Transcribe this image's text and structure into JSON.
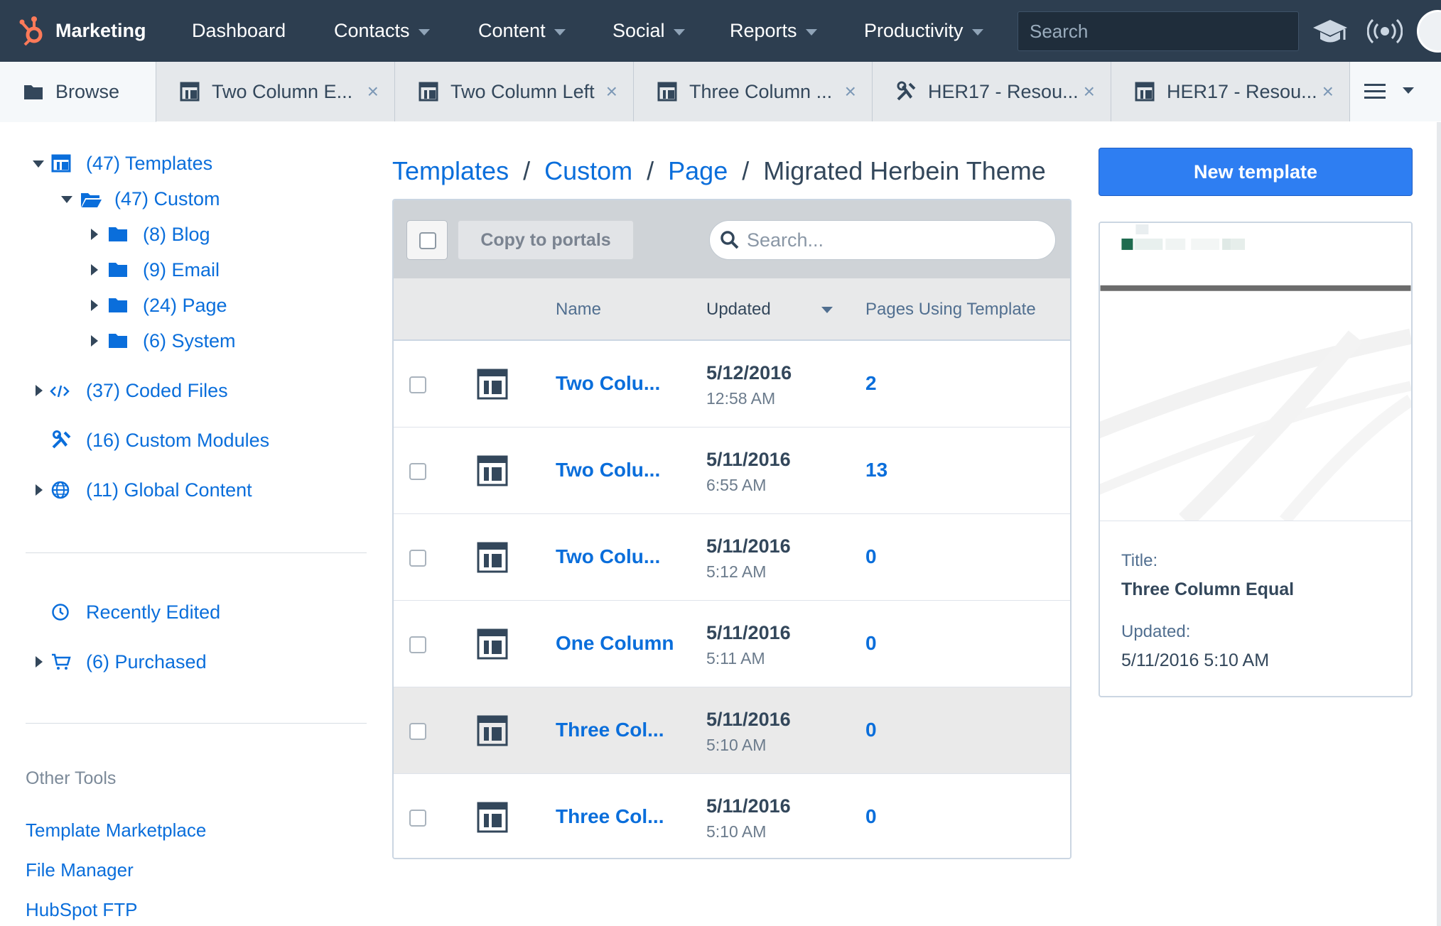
{
  "topnav": {
    "brand": "Marketing",
    "items": [
      "Dashboard",
      "Contacts",
      "Content",
      "Social",
      "Reports",
      "Productivity"
    ],
    "search_placeholder": "Search",
    "icons": [
      "hubspot-sprocket-icon",
      "academy-icon",
      "notifications-icon",
      "avatar"
    ]
  },
  "tabs": [
    {
      "label": "Browse",
      "icon": "folder-icon",
      "active": true
    },
    {
      "label": "Two Column E...",
      "icon": "template-icon"
    },
    {
      "label": "Two Column Left",
      "icon": "template-icon"
    },
    {
      "label": "Three Column ...",
      "icon": "template-icon"
    },
    {
      "label": "HER17 - Resou...",
      "icon": "tools-icon"
    },
    {
      "label": "HER17 - Resou...",
      "icon": "template-icon"
    }
  ],
  "tab_close": "×",
  "sidebar": {
    "tree": [
      {
        "label": "(47) Templates",
        "icon": "template-icon"
      },
      {
        "label": "(47) Custom",
        "icon": "folder-open-icon"
      },
      {
        "label": "(8) Blog",
        "icon": "folder-icon"
      },
      {
        "label": "(9) Email",
        "icon": "folder-icon"
      },
      {
        "label": "(24) Page",
        "icon": "folder-icon"
      },
      {
        "label": "(6) System",
        "icon": "folder-icon"
      },
      {
        "label": "(37) Coded Files",
        "icon": "code-icon"
      },
      {
        "label": "(16) Custom Modules",
        "icon": "tools-icon"
      },
      {
        "label": "(11) Global Content",
        "icon": "globe-icon"
      },
      {
        "label": "Recently Edited",
        "icon": "clock-icon"
      },
      {
        "label": "(6) Purchased",
        "icon": "cart-icon"
      }
    ],
    "other_tools_heading": "Other Tools",
    "other_tools": [
      "Template Marketplace",
      "File Manager",
      "HubSpot FTP"
    ]
  },
  "breadcrumb": {
    "links": [
      "Templates",
      "Custom",
      "Page"
    ],
    "separator": "/",
    "current": "Migrated Herbein Theme"
  },
  "toolbar": {
    "copy_label": "Copy to portals",
    "search_placeholder": "Search..."
  },
  "table": {
    "columns": [
      "Name",
      "Updated",
      "Pages Using Template"
    ],
    "sorted_column": "Updated",
    "rows": [
      {
        "name": "Two Colu...",
        "date": "5/12/2016",
        "time": "12:58 AM",
        "pages": "2"
      },
      {
        "name": "Two Colu...",
        "date": "5/11/2016",
        "time": "6:55 AM",
        "pages": "13"
      },
      {
        "name": "Two Colu...",
        "date": "5/11/2016",
        "time": "5:12 AM",
        "pages": "0"
      },
      {
        "name": "One Column",
        "date": "5/11/2016",
        "time": "5:11 AM",
        "pages": "0"
      },
      {
        "name": "Three Col...",
        "date": "5/11/2016",
        "time": "5:10 AM",
        "pages": "0",
        "hovered": true
      },
      {
        "name": "Three Col...",
        "date": "5/11/2016",
        "time": "5:10 AM",
        "pages": "0"
      }
    ]
  },
  "new_template_label": "New template",
  "preview": {
    "title_label": "Title:",
    "title_value": "Three Column Equal",
    "updated_label": "Updated:",
    "updated_value": "5/11/2016 5:10 AM"
  },
  "colors": {
    "nav_bg": "#2d3e50",
    "link": "#0a6edb",
    "accent_orange": "#ff7a59",
    "primary_button": "#2e7ef2"
  }
}
